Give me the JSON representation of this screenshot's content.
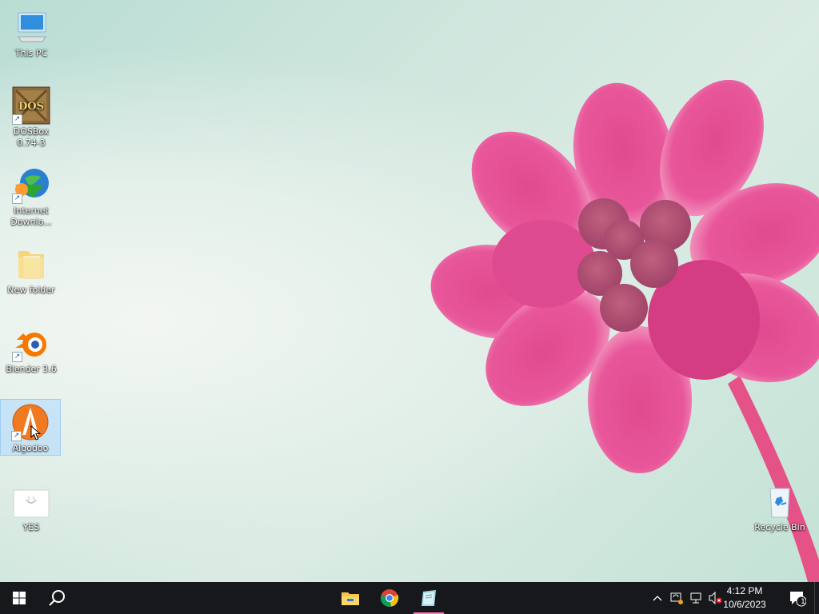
{
  "desktop": {
    "icons": [
      {
        "label": "This PC"
      },
      {
        "label": "DOSBox 0.74-3",
        "img_text": "DOS"
      },
      {
        "label": "Internet Downlo..."
      },
      {
        "label": "New folder"
      },
      {
        "label": "Blender 3.6"
      },
      {
        "label": "Algodoo"
      },
      {
        "label": "YES"
      },
      {
        "label": "Recycle Bin"
      }
    ],
    "selected_icon": "Algodoo"
  },
  "taskbar": {
    "start_icon": "windows-logo-icon",
    "search_icon": "search-icon",
    "pinned": [
      {
        "name": "file-explorer-icon"
      },
      {
        "name": "chrome-icon"
      },
      {
        "name": "notepad-icon",
        "active": true
      }
    ],
    "tray": {
      "time": "4:12 PM",
      "date": "10/6/2023",
      "notification_count": "1"
    }
  },
  "colors": {
    "taskbar_bg": "#16181c",
    "selection": "#add8ff",
    "flower_pink": "#e8438f",
    "active_indicator": "#ff7ab6"
  }
}
